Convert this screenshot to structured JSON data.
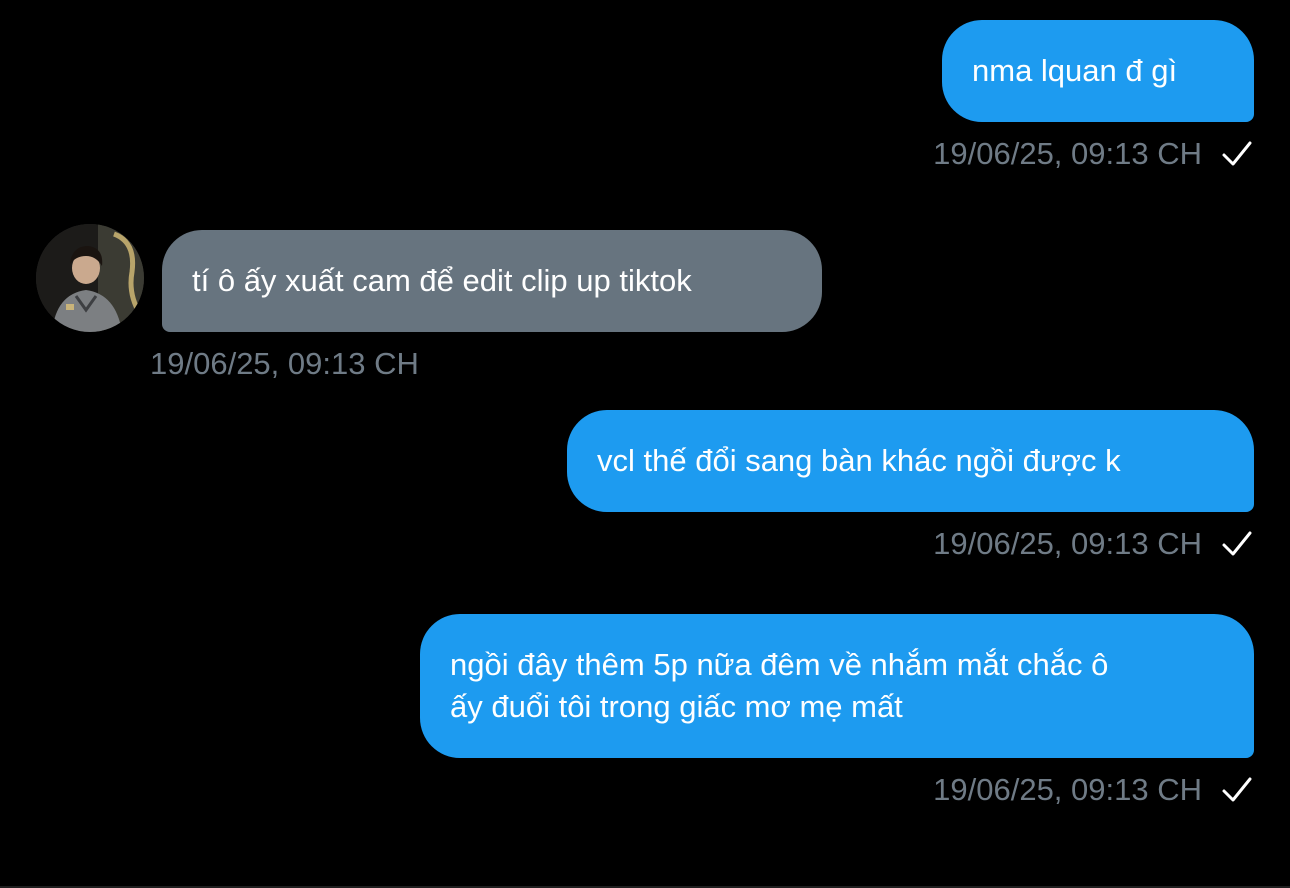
{
  "conversation": {
    "messages": [
      {
        "direction": "outgoing",
        "text": "nma lquan đ gì",
        "timestamp": "19/06/25, 09:13 CH",
        "status_icon": "checkmark-icon"
      },
      {
        "direction": "incoming",
        "text": "tí ô ấy xuất cam để edit clip up tiktok",
        "timestamp": "19/06/25, 09:13 CH",
        "avatar_icon": "avatar"
      },
      {
        "direction": "outgoing",
        "text": "vcl thế đổi sang bàn khác ngồi được k",
        "timestamp": "19/06/25, 09:13 CH",
        "status_icon": "checkmark-icon"
      },
      {
        "direction": "outgoing",
        "lines": [
          "ngồi đây thêm 5p nữa đêm về nhắm mắt chắc ô",
          "ấy đuổi tôi trong giấc mơ mẹ mất"
        ],
        "timestamp": "19/06/25, 09:13 CH",
        "status_icon": "checkmark-icon"
      }
    ]
  },
  "colors": {
    "background": "#000000",
    "outgoing_bubble": "#1d9bf0",
    "incoming_bubble": "#67747f",
    "timestamp": "#6f7b86",
    "text": "#ffffff"
  }
}
